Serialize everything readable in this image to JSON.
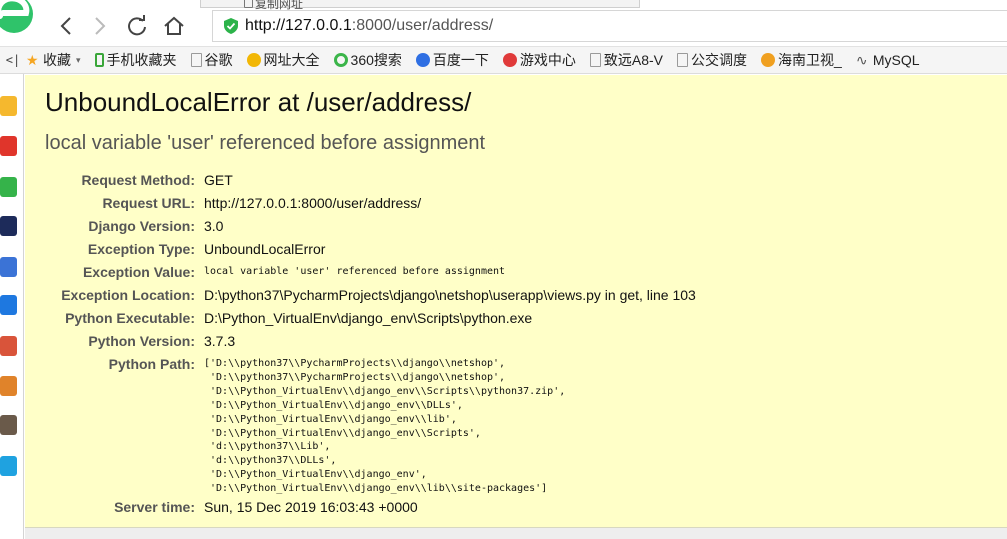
{
  "browser": {
    "copy_tip": "复制网址",
    "url_host": "http://127.0.0.1",
    "url_rest": ":8000/user/address/"
  },
  "bookmarks": {
    "toggle": "<|",
    "items": [
      {
        "label": "收藏",
        "icon": "star-icon",
        "color": "#f5a623",
        "dropdown": true
      },
      {
        "label": "手机收藏夹",
        "icon": "phone-icon",
        "color": "#3aa63a"
      },
      {
        "label": "谷歌",
        "icon": "page-icon",
        "color": "#9a9a9a"
      },
      {
        "label": "网址大全",
        "icon": "site-nav-icon",
        "color": "#f2b705"
      },
      {
        "label": "360搜索",
        "icon": "360-icon",
        "color": "#3bb54a"
      },
      {
        "label": "百度一下",
        "icon": "baidu-paw-icon",
        "color": "#2f6fe3"
      },
      {
        "label": "游戏中心",
        "icon": "game-icon",
        "color": "#e03a3a"
      },
      {
        "label": "致远A8-V",
        "icon": "page-icon",
        "color": "#9a9a9a"
      },
      {
        "label": "公交调度",
        "icon": "page-icon",
        "color": "#9a9a9a"
      },
      {
        "label": "海南卫视_",
        "icon": "tv-icon",
        "color": "#f0a020"
      },
      {
        "label": "MySQL",
        "icon": "mysql-icon",
        "color": "#555555"
      }
    ]
  },
  "error": {
    "title": "UnboundLocalError at /user/address/",
    "subtitle": "local variable 'user' referenced before assignment"
  },
  "meta": [
    {
      "label": "Request Method:",
      "value": "GET"
    },
    {
      "label": "Request URL:",
      "value": "http://127.0.0.1:8000/user/address/"
    },
    {
      "label": "Django Version:",
      "value": "3.0"
    },
    {
      "label": "Exception Type:",
      "value": "UnboundLocalError"
    },
    {
      "label": "Exception Value:",
      "value": "local variable 'user' referenced before assignment",
      "mono": true
    },
    {
      "label": "Exception Location:",
      "value": "D:\\python37\\PycharmProjects\\django\\netshop\\userapp\\views.py in get, line 103"
    },
    {
      "label": "Python Executable:",
      "value": "D:\\Python_VirtualEnv\\django_env\\Scripts\\python.exe"
    },
    {
      "label": "Python Version:",
      "value": "3.7.3"
    }
  ],
  "python_path_label": "Python Path:",
  "python_path": [
    "['D:\\\\python37\\\\PycharmProjects\\\\django\\\\netshop',",
    " 'D:\\\\python37\\\\PycharmProjects\\\\django\\\\netshop',",
    " 'D:\\\\Python_VirtualEnv\\\\django_env\\\\Scripts\\\\python37.zip',",
    " 'D:\\\\Python_VirtualEnv\\\\django_env\\\\DLLs',",
    " 'D:\\\\Python_VirtualEnv\\\\django_env\\\\lib',",
    " 'D:\\\\Python_VirtualEnv\\\\django_env\\\\Scripts',",
    " 'd:\\\\python37\\\\Lib',",
    " 'd:\\\\python37\\\\DLLs',",
    " 'D:\\\\Python_VirtualEnv\\\\django_env',",
    " 'D:\\\\Python_VirtualEnv\\\\django_env\\\\lib\\\\site-packages']"
  ],
  "server_time": {
    "label": "Server time:",
    "value": "Sun, 15 Dec 2019 16:03:43 +0000"
  },
  "sidebar_icons": [
    {
      "name": "favorites-star-icon",
      "color": "#f5b82e"
    },
    {
      "name": "weibo-icon",
      "color": "#e0352b"
    },
    {
      "name": "mail-icon",
      "color": "#35b34a"
    },
    {
      "name": "news-app-icon",
      "color": "#1d2b5a"
    },
    {
      "name": "document-icon",
      "color": "#3b73d6"
    },
    {
      "name": "chat-icon",
      "color": "#1e78e0"
    },
    {
      "name": "game-icon-1",
      "color": "#d9543a"
    },
    {
      "name": "game-icon-2",
      "color": "#e0832a"
    },
    {
      "name": "game-icon-3",
      "color": "#6a5a4a"
    },
    {
      "name": "app-icon",
      "color": "#1fa2e0"
    }
  ]
}
